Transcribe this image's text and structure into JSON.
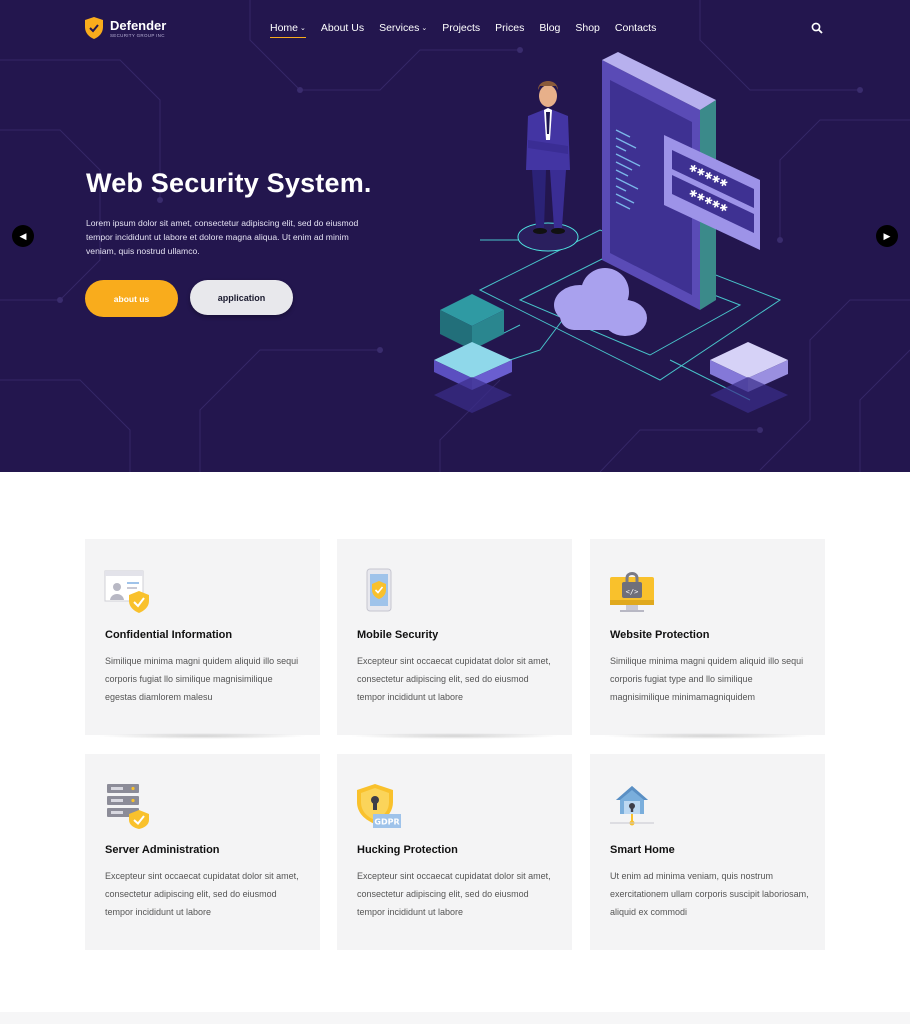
{
  "brand": {
    "name": "Defender",
    "tagline": "SECURITY GROUP INC"
  },
  "nav": {
    "items": [
      {
        "label": "Home",
        "dropdown": true,
        "active": true
      },
      {
        "label": "About Us",
        "dropdown": false
      },
      {
        "label": "Services",
        "dropdown": true
      },
      {
        "label": "Projects",
        "dropdown": false
      },
      {
        "label": "Prices",
        "dropdown": false
      },
      {
        "label": "Blog",
        "dropdown": false
      },
      {
        "label": "Shop",
        "dropdown": false
      },
      {
        "label": "Contacts",
        "dropdown": false
      }
    ],
    "chevron": "⌄",
    "search_icon": "search-icon"
  },
  "hero": {
    "title": "Web Security System.",
    "text": "Lorem ipsum dolor sit amet, consectetur adipiscing elit, sed do eiusmod tempor incididunt ut labore et dolore magna aliqua. Ut enim ad minim veniam, quis nostrud ullamco.",
    "primary_button": "about us",
    "secondary_button": "application",
    "prev_arrow": "◀",
    "next_arrow": "▶"
  },
  "services": [
    {
      "title": "Confidential Information",
      "text": "Similique minima magni quidem aliquid illo sequi corporis fugiat llo similique magnisimilique egestas diamlorem malesu",
      "icon": "id-card-shield-icon"
    },
    {
      "title": "Mobile Security",
      "text": "Excepteur sint occaecat cupidatat dolor sit amet, consectetur adipiscing elit, sed do eiusmod tempor incididunt ut labore",
      "icon": "phone-shield-icon"
    },
    {
      "title": "Website Protection",
      "text": "Similique minima magni quidem aliquid illo sequi corporis fugiat type and llo similique magnisimilique minimamagniquidem",
      "icon": "monitor-lock-icon"
    },
    {
      "title": "Server Administration",
      "text": "Excepteur sint occaecat cupidatat dolor sit amet, consectetur adipiscing elit, sed do eiusmod tempor incididunt ut labore",
      "icon": "server-shield-icon"
    },
    {
      "title": "Hucking Protection",
      "text": "Excepteur sint occaecat cupidatat dolor sit amet, consectetur adipiscing elit, sed do eiusmod tempor incididunt ut labore",
      "icon": "gdpr-shield-icon",
      "badge": "GDPR"
    },
    {
      "title": "Smart Home",
      "text": "Ut enim ad minima veniam, quis nostrum exercitationem ullam corporis suscipit laboriosam, aliquid ex commodi",
      "icon": "smart-home-icon"
    }
  ],
  "colors": {
    "hero_bg": "#23164e",
    "accent": "#f9ac1c",
    "card_bg": "#f4f4f5",
    "cyan": "#4fe3e0",
    "violet": "#6a5acd"
  }
}
